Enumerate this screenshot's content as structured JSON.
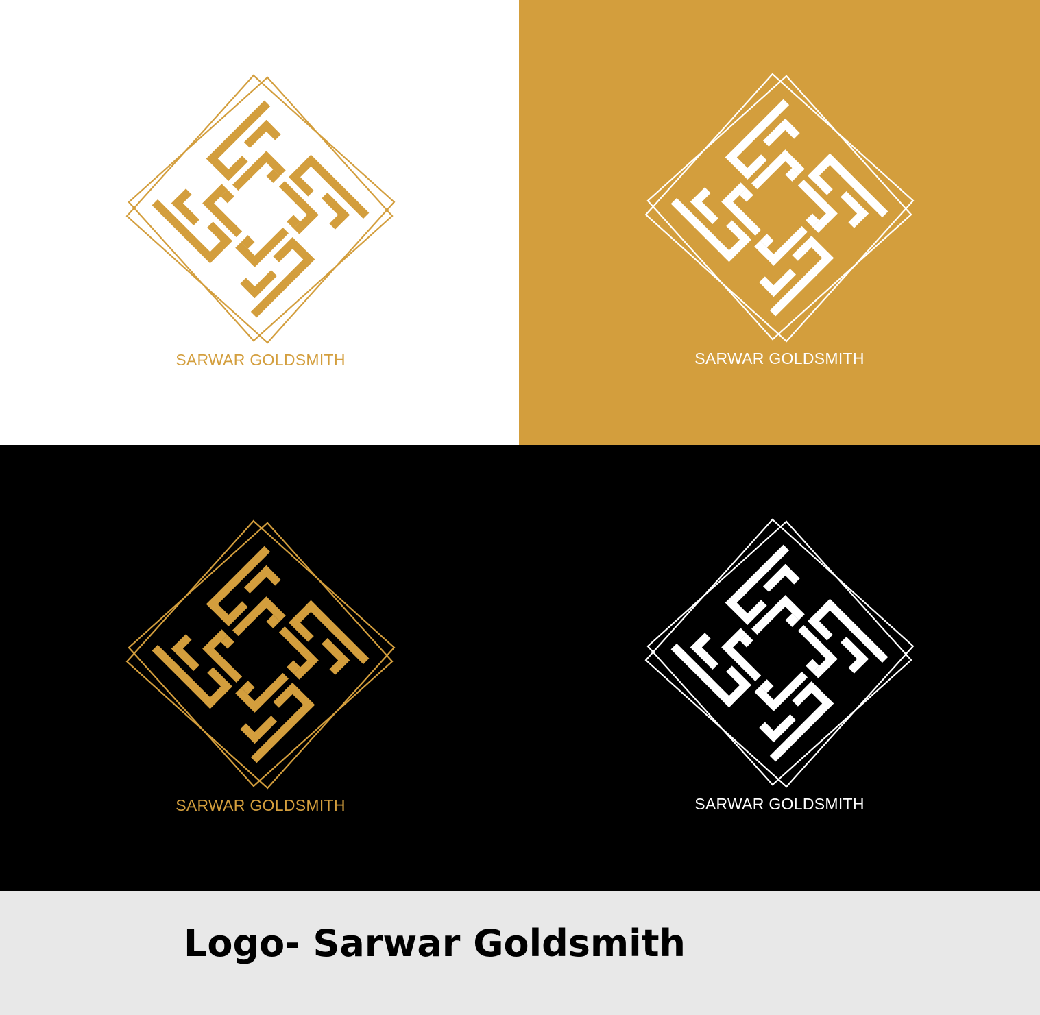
{
  "colors": {
    "gold": "#d39e3d",
    "white": "#ffffff",
    "black": "#000000",
    "footer_bg": "#e8e8e8"
  },
  "variants": [
    {
      "name": "gold-on-white",
      "background": "#ffffff",
      "mark_color": "#d39e3d",
      "label": "SARWAR GOLDSMITH"
    },
    {
      "name": "white-on-gold",
      "background": "#d39e3d",
      "mark_color": "#ffffff",
      "label": "SARWAR GOLDSMITH"
    },
    {
      "name": "gold-on-black",
      "background": "#000000",
      "mark_color": "#d39e3d",
      "label": "SARWAR GOLDSMITH"
    },
    {
      "name": "white-on-black",
      "background": "#000000",
      "mark_color": "#ffffff",
      "label": "SARWAR GOLDSMITH"
    }
  ],
  "icons": {
    "logo_mark": "kufic-square-calligraphy-diamond-icon"
  },
  "footer": {
    "title": "Logo- Sarwar Goldsmith"
  }
}
